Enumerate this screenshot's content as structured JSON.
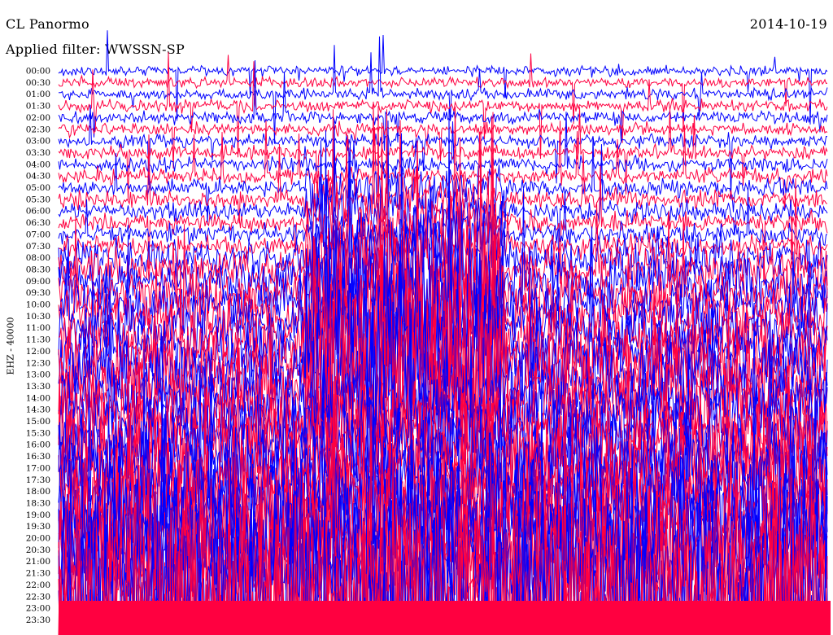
{
  "header": {
    "station": "CL Panormo",
    "filter": "Applied filter: WWSSN-SP",
    "date": "2014-10-19"
  },
  "axis": {
    "channel_label": "EHZ - 40000"
  },
  "colors": {
    "trace_a": "#0000ff",
    "trace_b": "#ff0040",
    "background": "#ffffff"
  },
  "chart_data": {
    "type": "line",
    "title": "CL Panormo",
    "subtitle": "Applied filter: WWSSN-SP",
    "date": "2014-10-19",
    "ylabel": "EHZ - 40000",
    "xlabel": "",
    "grid": false,
    "categories": [
      "00:00",
      "00:30",
      "01:00",
      "01:30",
      "02:00",
      "02:30",
      "03:00",
      "03:30",
      "04:00",
      "04:30",
      "05:00",
      "05:30",
      "06:00",
      "06:30",
      "07:00",
      "07:30",
      "08:00",
      "08:30",
      "09:00",
      "09:30",
      "10:00",
      "10:30",
      "11:00",
      "11:30",
      "12:00",
      "12:30",
      "13:00",
      "13:30",
      "14:00",
      "14:30",
      "15:00",
      "15:30",
      "16:00",
      "16:30",
      "17:00",
      "17:30",
      "18:00",
      "18:30",
      "19:00",
      "19:30",
      "20:00",
      "20:30",
      "21:00",
      "21:30",
      "22:00",
      "22:30",
      "23:00",
      "23:30"
    ],
    "series_colors": [
      "#0000ff",
      "#ff0040"
    ]
  }
}
